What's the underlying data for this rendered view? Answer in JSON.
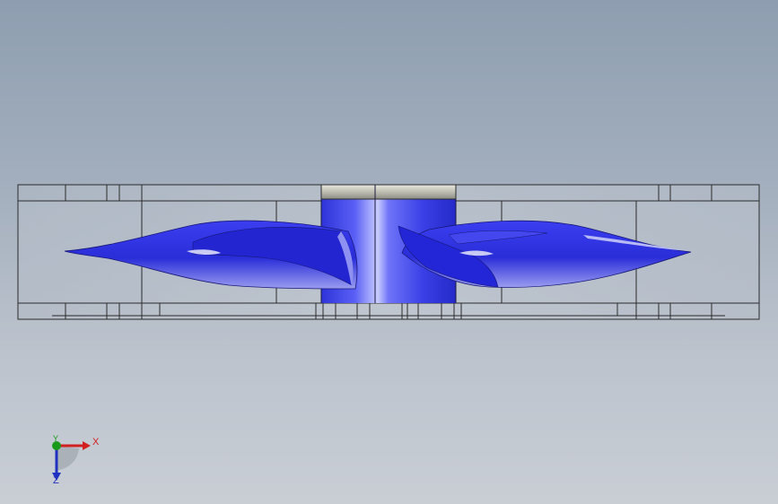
{
  "window": {
    "type": "cad-viewport",
    "background_top": "#8e9eb0",
    "background_bottom": "#c9ced5"
  },
  "model": {
    "name": "fan-assembly",
    "view": "side",
    "blade_color": "#2a2ee0",
    "hub_color": "#3a3fe6",
    "hub_cap_color": "#c8c8bc",
    "housing_edge_color": "#2b2b2b"
  },
  "triad": {
    "x_label": "X",
    "y_label": "Y",
    "z_label": "Z",
    "x_color": "#d22020",
    "y_color": "#1a9a1a",
    "z_color": "#2030c0"
  }
}
